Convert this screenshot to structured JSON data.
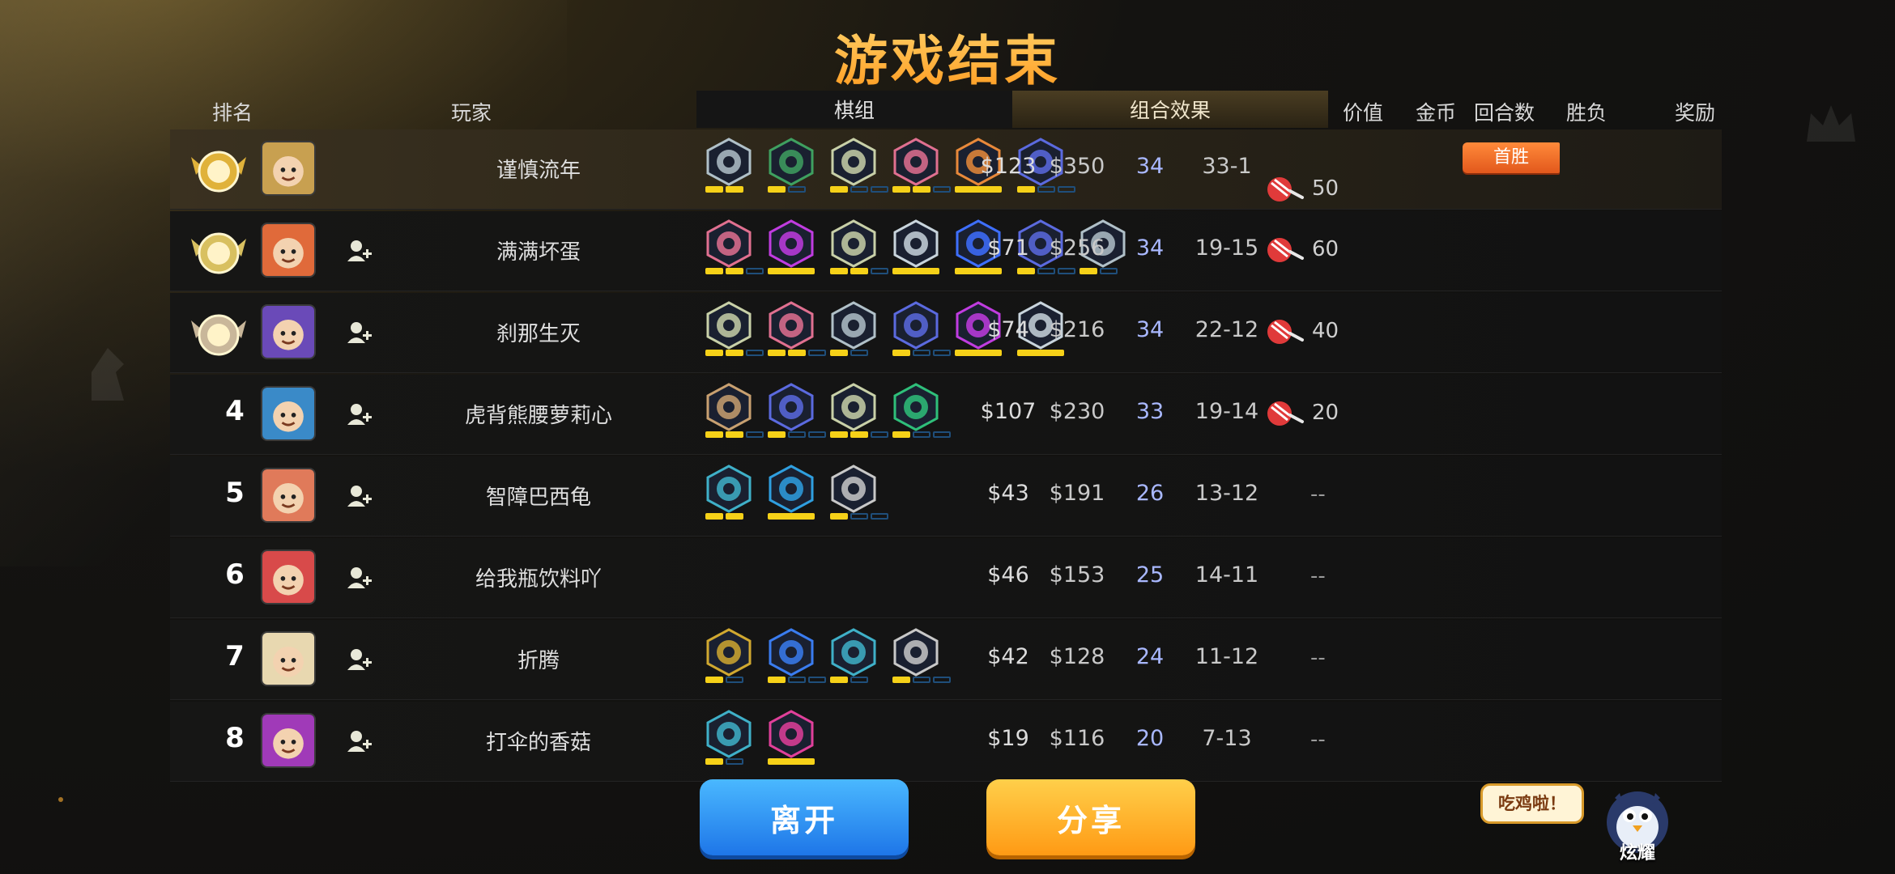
{
  "title": "游戏结束",
  "headers": {
    "rank": "排名",
    "player": "玩家",
    "pieces_tab": "棋组",
    "combo_tab": "组合效果",
    "value": "价值",
    "gold": "金币",
    "rounds": "回合数",
    "record": "胜负",
    "reward": "奖励"
  },
  "first_win_label": "首胜",
  "rows": [
    {
      "rank": "1",
      "name": "谨慎流年",
      "value": "$123",
      "gold": "$350",
      "rounds": "34",
      "record": "33-1",
      "reward": "50",
      "pieces": [
        [
          "#9aa",
          "#b0c0c8"
        ],
        [
          "#2a8",
          "#3fa060"
        ],
        [
          "#b8c9a0",
          "#c8d0a8"
        ],
        [
          "#c56",
          "#e07090"
        ],
        [
          "#e57",
          "#e8893a"
        ],
        [
          "#68f",
          "#5b6adf"
        ]
      ]
    },
    {
      "rank": "2",
      "name": "满满坏蛋",
      "value": "$71",
      "gold": "$256",
      "rounds": "34",
      "record": "19-15",
      "reward": "60",
      "pieces": [
        [
          "#c56",
          "#e07090"
        ],
        [
          "#c3f",
          "#c03ce0"
        ],
        [
          "#b8c9a0",
          "#c8d0a8"
        ],
        [
          "#cdd",
          "#c8d4dc"
        ],
        [
          "#36f",
          "#3e6fff"
        ],
        [
          "#68f",
          "#5b6adf"
        ],
        [
          "#9aa",
          "#b0c0c8"
        ]
      ]
    },
    {
      "rank": "3",
      "name": "刹那生灭",
      "value": "$74",
      "gold": "$216",
      "rounds": "34",
      "record": "22-12",
      "reward": "40",
      "pieces": [
        [
          "#b8c9a0",
          "#c8d0a8"
        ],
        [
          "#c56",
          "#e07090"
        ],
        [
          "#9aa",
          "#b0c0c8"
        ],
        [
          "#68f",
          "#5b6adf"
        ],
        [
          "#c3f",
          "#c03ce0"
        ],
        [
          "#cdd",
          "#c8d4dc"
        ]
      ]
    },
    {
      "rank": "4",
      "name": "虎背熊腰萝莉心",
      "value": "$107",
      "gold": "$230",
      "rounds": "33",
      "record": "19-14",
      "reward": "20",
      "pieces": [
        [
          "#b96",
          "#c8a070"
        ],
        [
          "#68f",
          "#5b6adf"
        ],
        [
          "#b8c9a0",
          "#c8d0a8"
        ],
        [
          "#3c8",
          "#2fbf7a"
        ]
      ]
    },
    {
      "rank": "5",
      "name": "智障巴西龟",
      "value": "$43",
      "gold": "$191",
      "rounds": "26",
      "record": "13-12",
      "reward": "--",
      "pieces": [
        [
          "#4bc",
          "#3fb0c8"
        ],
        [
          "#3ad",
          "#2f9fe0"
        ],
        [
          "#ccc",
          "#c8c8c8"
        ]
      ]
    },
    {
      "rank": "6",
      "name": "给我瓶饮料吖",
      "value": "$46",
      "gold": "$153",
      "rounds": "25",
      "record": "14-11",
      "reward": "--",
      "pieces": []
    },
    {
      "rank": "7",
      "name": "折腾",
      "value": "$42",
      "gold": "$128",
      "rounds": "24",
      "record": "11-12",
      "reward": "--",
      "pieces": [
        [
          "#ca4",
          "#d0a830"
        ],
        [
          "#37f",
          "#3a7cf0"
        ],
        [
          "#4bc",
          "#3fb0c8"
        ],
        [
          "#ccc",
          "#c8c8c8"
        ]
      ]
    },
    {
      "rank": "8",
      "name": "打伞的香菇",
      "value": "$19",
      "gold": "$116",
      "rounds": "20",
      "record": "7-13",
      "reward": "--",
      "pieces": [
        [
          "#4bc",
          "#3fb0c8"
        ],
        [
          "#e4a",
          "#e0409a"
        ]
      ]
    }
  ],
  "buttons": {
    "leave": "离开",
    "share": "分享"
  },
  "bubble_text": "吃鸡啦！",
  "mascot_label": "炫耀",
  "colors": {
    "title": "#ff9a1f",
    "rounds": "#a9b8ff",
    "star_on": "#f6d118",
    "leave": "#1e76e8",
    "share": "#ff9a14"
  }
}
